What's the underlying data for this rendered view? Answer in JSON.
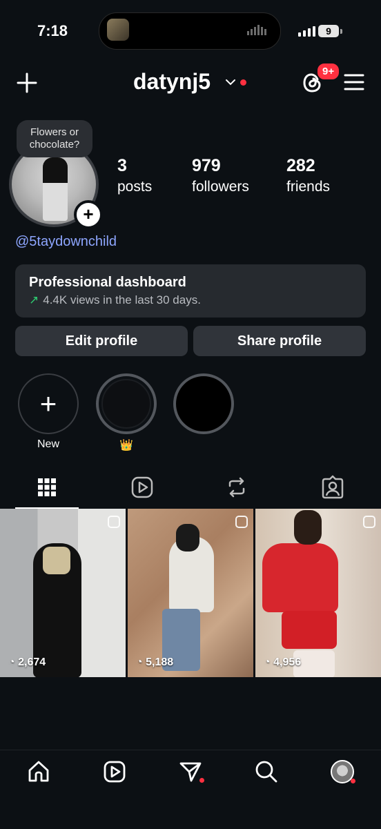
{
  "status_bar": {
    "time": "7:18",
    "battery": "9"
  },
  "header": {
    "username": "datynj5",
    "threads_badge": "9+"
  },
  "profile": {
    "note_line1": "Flowers or",
    "note_line2": "chocolate?",
    "handle": "@5taydownchild",
    "stats": [
      {
        "value": "3",
        "label": "posts"
      },
      {
        "value": "979",
        "label": "followers"
      },
      {
        "value": "282",
        "label": "friends"
      }
    ]
  },
  "dashboard": {
    "title": "Professional dashboard",
    "subtitle": "4.4K views in the last 30 days."
  },
  "buttons": {
    "edit": "Edit profile",
    "share": "Share profile"
  },
  "highlights": [
    {
      "label": "New"
    },
    {
      "label": "👑"
    },
    {
      "label": ""
    }
  ],
  "tabs": [
    "grid-icon",
    "reels-icon",
    "reposts-icon",
    "tagged-icon"
  ],
  "posts": [
    {
      "views": "2,674"
    },
    {
      "views": "5,188"
    },
    {
      "views": "4,956"
    }
  ],
  "nav": [
    "home-icon",
    "reels-icon",
    "messages-icon",
    "search-icon",
    "profile-avatar"
  ],
  "colors": {
    "background": "#0c1014",
    "accent_red": "#ff3040",
    "link": "#8ea6ff",
    "trend_green": "#2ecc71"
  }
}
